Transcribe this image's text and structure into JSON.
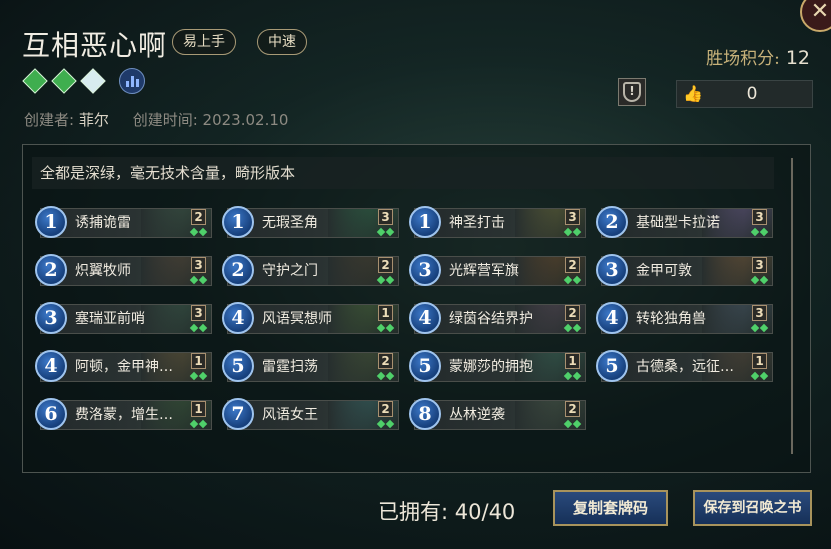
{
  "deck": {
    "title": "互相恶心啊",
    "tags": [
      "易上手",
      "中速"
    ],
    "creator_label": "创建者:",
    "creator_name": "菲尔",
    "created_label": "创建时间:",
    "created_date": "2023.02.10",
    "description": "全都是深绿，毫无技术含量，畸形版本"
  },
  "score": {
    "label": "胜场积分:",
    "value": "12"
  },
  "likes": {
    "count": "0"
  },
  "cards": [
    {
      "cost": "1",
      "name": "诱捕诡雷",
      "count": "2",
      "art": "#3f5a4a"
    },
    {
      "cost": "1",
      "name": "无瑕圣角",
      "count": "3",
      "art": "#2f6a4a"
    },
    {
      "cost": "1",
      "name": "神圣打击",
      "count": "3",
      "art": "#6a6a3a"
    },
    {
      "cost": "2",
      "name": "基础型卡拉诺",
      "count": "3",
      "art": "#6a5a8a"
    },
    {
      "cost": "2",
      "name": "炽翼牧师",
      "count": "3",
      "art": "#5a4a3a"
    },
    {
      "cost": "2",
      "name": "守护之门",
      "count": "2",
      "art": "#4a4030"
    },
    {
      "cost": "3",
      "name": "光辉营军旗",
      "count": "2",
      "art": "#6a4a2a"
    },
    {
      "cost": "3",
      "name": "金甲可敦",
      "count": "3",
      "art": "#7a5a3a"
    },
    {
      "cost": "3",
      "name": "塞瑞亚前哨",
      "count": "3",
      "art": "#3a5a4a"
    },
    {
      "cost": "4",
      "name": "风语冥想师",
      "count": "1",
      "art": "#4a6a3a"
    },
    {
      "cost": "4",
      "name": "绿茵谷结界护",
      "count": "2",
      "art": "#5a4a5a"
    },
    {
      "cost": "4",
      "name": "转轮独角兽",
      "count": "3",
      "art": "#4a5a6a"
    },
    {
      "cost": "4",
      "name": "阿顿，金甲神…",
      "count": "1",
      "art": "#6a5a3a"
    },
    {
      "cost": "5",
      "name": "雷霆扫荡",
      "count": "2",
      "art": "#4a5a3a"
    },
    {
      "cost": "5",
      "name": "蒙娜莎的拥抱",
      "count": "1",
      "art": "#3a6a5a"
    },
    {
      "cost": "5",
      "name": "古德桑，远征…",
      "count": "1",
      "art": "#5a4a3a"
    },
    {
      "cost": "6",
      "name": "费洛蒙，增生…",
      "count": "1",
      "art": "#3a5a3a"
    },
    {
      "cost": "7",
      "name": "风语女王",
      "count": "2",
      "art": "#3a6a6a"
    },
    {
      "cost": "8",
      "name": "丛林逆袭",
      "count": "2",
      "art": "#4a5a4a"
    }
  ],
  "footer": {
    "owned_label": "已拥有:",
    "owned_value": "40/40",
    "copy_button": "复制套牌码",
    "save_button": "保存到召唤之书"
  },
  "icons": {
    "close": "close-icon",
    "gems": [
      "green-gem-icon",
      "green-gem-icon",
      "white-gem-icon"
    ],
    "stats": "stats-icon",
    "report": "report-icon",
    "like": "thumbs-up-icon"
  }
}
